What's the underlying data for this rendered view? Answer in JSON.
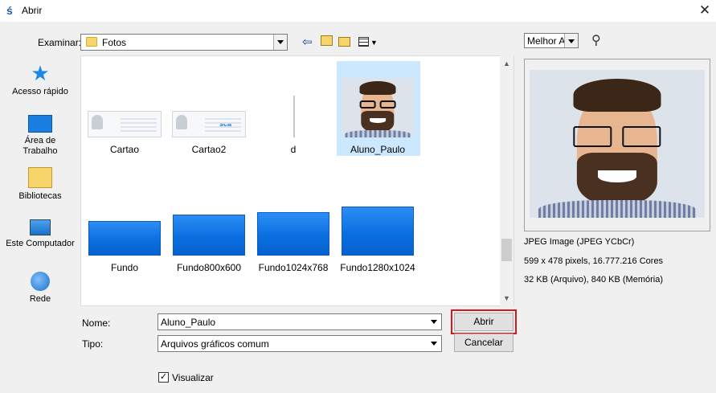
{
  "window": {
    "title": "Abrir",
    "app_icon": "s-logo",
    "close_glyph": "✕"
  },
  "look_in": {
    "label": "Examinar:",
    "value": "Fotos"
  },
  "toolbar_icons": [
    "back-icon",
    "up-folder-icon",
    "new-folder-icon",
    "view-menu-icon"
  ],
  "places": [
    {
      "label": "Acesso rápido",
      "icon": "quick-access-star-icon"
    },
    {
      "label": "Área de Trabalho",
      "icon": "desktop-icon"
    },
    {
      "label": "Bibliotecas",
      "icon": "libraries-icon"
    },
    {
      "label": "Este Computador",
      "icon": "computer-icon"
    },
    {
      "label": "Rede",
      "icon": "network-icon"
    }
  ],
  "files": [
    {
      "name": "Cartao",
      "type": "card"
    },
    {
      "name": "Cartao2",
      "type": "card"
    },
    {
      "name": "d",
      "type": "partial"
    },
    {
      "name": "Aluno_Paulo",
      "type": "photo",
      "selected": true
    },
    {
      "name": "Fundo",
      "type": "blue"
    },
    {
      "name": "Fundo800x600",
      "type": "blue"
    },
    {
      "name": "Fundo1024x768",
      "type": "blue"
    },
    {
      "name": "Fundo1280x1024",
      "type": "blue"
    }
  ],
  "card_logo": "sca",
  "form": {
    "name_label": "Nome:",
    "name_value": "Aluno_Paulo",
    "type_label": "Tipo:",
    "type_value": "Arquivos gráficos comum",
    "open_button": "Abrir",
    "cancel_button": "Cancelar",
    "preview_checkbox_label": "Visualizar",
    "preview_checked": true
  },
  "preview": {
    "fit_mode": "Melhor Aj",
    "search_icon": "magnifier-icon",
    "info": [
      "JPEG Image (JPEG YCbCr)",
      "599 x 478 pixels, 16.777.216 Cores",
      "32 KB (Arquivo), 840 KB (Memória)"
    ]
  },
  "colors": {
    "selection": "#cce8ff",
    "focus_ring": "#d8161b",
    "thumb_blue": "#0a6fe0"
  }
}
